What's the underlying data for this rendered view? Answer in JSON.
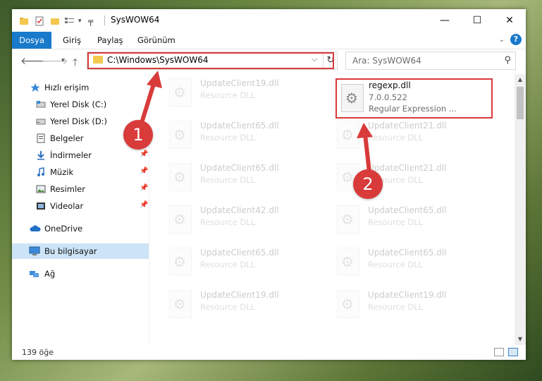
{
  "window": {
    "title": "SysWOW64",
    "controls": {
      "minimize": "—",
      "maximize": "☐",
      "close": "✕"
    }
  },
  "ribbon": {
    "tabs": [
      "Dosya",
      "Giriş",
      "Paylaş",
      "Görünüm"
    ]
  },
  "address": {
    "path": "C:\\Windows\\SysWOW64",
    "search_placeholder": "Ara: SysWOW64"
  },
  "sidebar": {
    "items": [
      {
        "label": "Hızlı erişim",
        "icon": "star-icon"
      },
      {
        "label": "Yerel Disk (C:)",
        "icon": "drive-icon"
      },
      {
        "label": "Yerel Disk (D:)",
        "icon": "drive-icon"
      },
      {
        "label": "Belgeler",
        "icon": "documents-icon"
      },
      {
        "label": "İndirmeler",
        "icon": "download-icon"
      },
      {
        "label": "Müzik",
        "icon": "music-icon"
      },
      {
        "label": "Resimler",
        "icon": "pictures-icon"
      },
      {
        "label": "Videolar",
        "icon": "videos-icon"
      },
      {
        "label": "OneDrive",
        "icon": "cloud-icon"
      },
      {
        "label": "Bu bilgisayar",
        "icon": "computer-icon"
      },
      {
        "label": "Ağ",
        "icon": "network-icon"
      }
    ]
  },
  "files": {
    "left_column": [
      {
        "name": "UpdateClient19.dll",
        "type": "Resource DLL"
      },
      {
        "name": "UpdateClient65.dll",
        "type": "Resource DLL"
      },
      {
        "name": "UpdateClient65.dll",
        "type": "Resource DLL"
      },
      {
        "name": "UpdateClient42.dll",
        "type": "Resource DLL"
      },
      {
        "name": "UpdateClient65.dll",
        "type": "Resource DLL"
      },
      {
        "name": "UpdateClient19.dll",
        "type": "Resource DLL"
      }
    ],
    "right_column": [
      {
        "name": "UpdateClient21.dll",
        "type": "Resource DLL"
      },
      {
        "name": "UpdateClient21.dll",
        "type": "Resource DLL"
      },
      {
        "name": "UpdateClient65.dll",
        "type": "Resource DLL"
      },
      {
        "name": "UpdateClient65.dll",
        "type": "Resource DLL"
      },
      {
        "name": "UpdateClient19.dll",
        "type": "Resource DLL"
      }
    ],
    "highlighted": {
      "name": "regexp.dll",
      "version": "7.0.0.522",
      "description": "Regular Expression ..."
    }
  },
  "status": {
    "count": "139 öğe"
  },
  "callouts": {
    "one": "1",
    "two": "2"
  },
  "colors": {
    "accent": "#1979ca",
    "highlight": "#d93a3a",
    "selected": "#cce4f7"
  }
}
